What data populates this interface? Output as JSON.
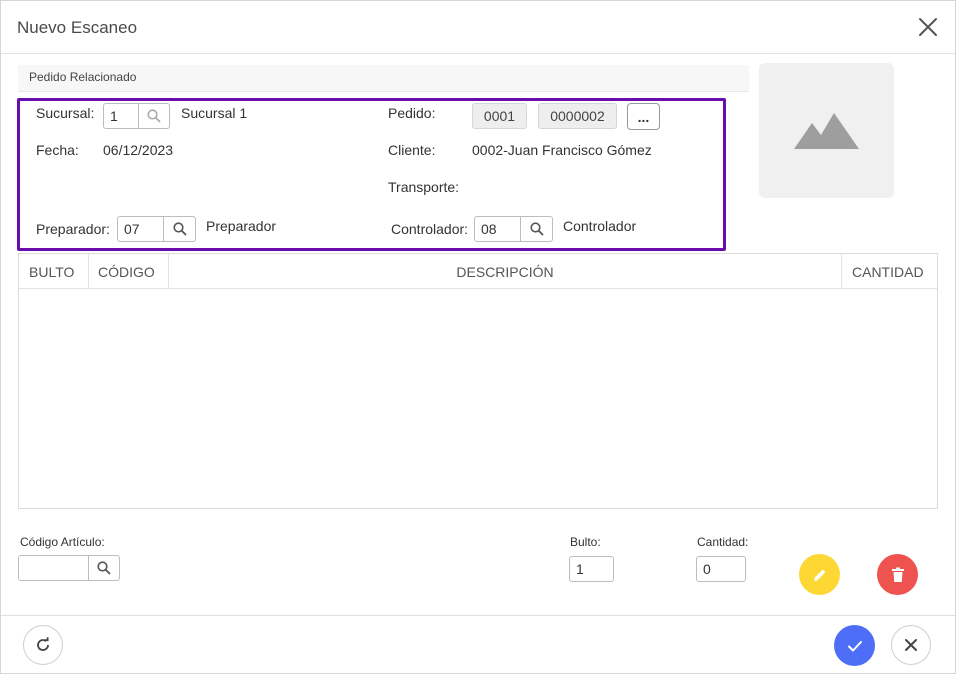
{
  "dialog": {
    "title": "Nuevo Escaneo",
    "close_icon": "close-icon"
  },
  "section": {
    "label": "Pedido Relacionado"
  },
  "form": {
    "sucursal_label": "Sucursal:",
    "sucursal_value": "1",
    "sucursal_name": "Sucursal 1",
    "fecha_label": "Fecha:",
    "fecha_value": "06/12/2023",
    "preparador_label": "Preparador:",
    "preparador_value": "07",
    "preparador_name": "Preparador",
    "pedido_label": "Pedido:",
    "pedido_part1": "0001",
    "pedido_part2": "0000002",
    "pedido_more": "...",
    "cliente_label": "Cliente:",
    "cliente_value": "0002-Juan Francisco Gómez",
    "transporte_label": "Transporte:",
    "controlador_label": "Controlador:",
    "controlador_value": "08",
    "controlador_name": "Controlador"
  },
  "grid": {
    "columns": [
      "BULTO",
      "CÓDIGO",
      "DESCRIPCIÓN",
      "CANTIDAD"
    ],
    "rows": []
  },
  "entry": {
    "codigo_label": "Código Artículo:",
    "codigo_value": "",
    "bulto_label": "Bulto:",
    "bulto_value": "1",
    "cantidad_label": "Cantidad:",
    "cantidad_value": "0"
  },
  "colors": {
    "highlight": "#6a0dad",
    "edit": "#fdd835",
    "delete": "#ef5350",
    "confirm": "#4f6ef7"
  }
}
